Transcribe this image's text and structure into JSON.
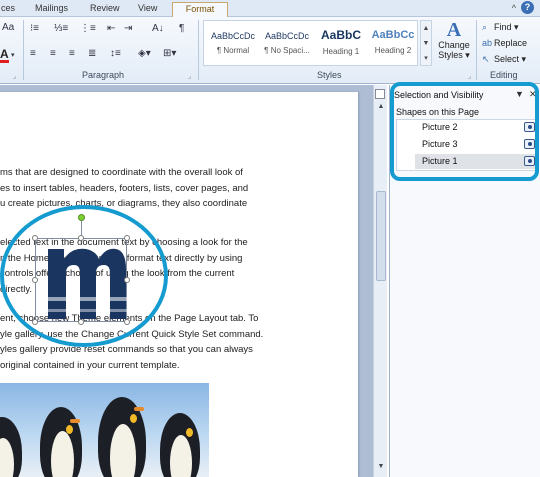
{
  "ribbon_tabs": [
    "ces",
    "Mailings",
    "Review",
    "View",
    "Format"
  ],
  "help_icon": "?",
  "paragraph_group_label": "Paragraph",
  "styles_group_label": "Styles",
  "editing_group_label": "Editing",
  "quick_styles": [
    {
      "preview": "AaBbCcDc",
      "name": "¶ Normal"
    },
    {
      "preview": "AaBbCcDc",
      "name": "¶ No Spaci..."
    },
    {
      "preview": "AaBbC",
      "name": "Heading 1"
    },
    {
      "preview": "AaBbCc",
      "name": "Heading 2"
    }
  ],
  "change_styles": {
    "icon": "A",
    "line1": "Change",
    "line2": "Styles ▾"
  },
  "editing_buttons": [
    {
      "icon": "binoculars-icon",
      "label": "Find ▾"
    },
    {
      "icon": "replace-icon",
      "label": "Replace"
    },
    {
      "icon": "select-icon",
      "label": "Select ▾"
    }
  ],
  "document": {
    "paragraph1": [
      "ms that are designed to coordinate with the overall look of",
      "es to insert tables, headers, footers, lists, cover pages, and",
      "u create pictures, charts, or diagrams, they also coordinate"
    ],
    "paragraph2": [
      "elected text in the document text by choosing a look for the",
      "n the Home tab. You can also format text directly by using",
      " controls offer a choice of using the look from the current",
      "directly."
    ],
    "paragraph3": [
      "ent, choose new Theme elements on the Page Layout tab. To",
      "yle gallery, use the Change Current Quick Style Set command.",
      "yles gallery provide reset commands so that you can always",
      "original contained in your current template."
    ]
  },
  "selection_pane": {
    "title": "Selection and Visibility",
    "dropdown": "▼",
    "close": "✕",
    "subtitle": "Shapes on this Page",
    "items": [
      {
        "label": "Picture 2",
        "selected": false,
        "visible": true
      },
      {
        "label": "Picture 3",
        "selected": false,
        "visible": true
      },
      {
        "label": "Picture 1",
        "selected": true,
        "visible": true
      }
    ]
  },
  "colors": {
    "highlight": "#159bd0",
    "logo": "#1a3560",
    "format_tab": "#c8a96b"
  }
}
